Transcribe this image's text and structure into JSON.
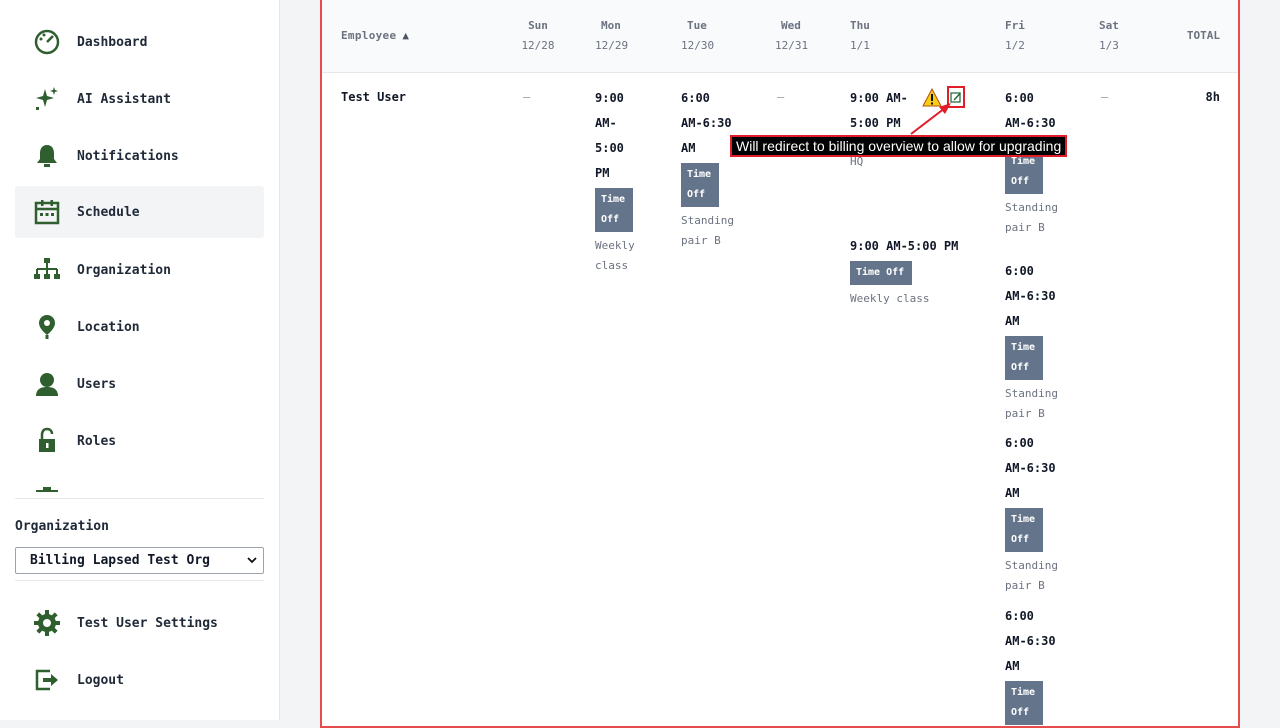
{
  "sidebar": {
    "items": [
      {
        "label": "Dashboard",
        "icon": "dashboard-icon"
      },
      {
        "label": "AI Assistant",
        "icon": "sparkle-icon"
      },
      {
        "label": "Notifications",
        "icon": "bell-icon"
      },
      {
        "label": "Schedule",
        "icon": "calendar-icon",
        "active": true
      },
      {
        "label": "Organization",
        "icon": "org-chart-icon"
      },
      {
        "label": "Location",
        "icon": "map-pin-icon"
      },
      {
        "label": "Users",
        "icon": "user-icon"
      },
      {
        "label": "Roles",
        "icon": "unlock-icon"
      }
    ],
    "organization_label": "Organization",
    "organization_selected": "Billing Lapsed Test Org",
    "settings_label": "Test User Settings",
    "logout_label": "Logout"
  },
  "colors": {
    "icon": "#2f5f2f",
    "badge": "#64748b",
    "highlight": "#e11d2a"
  },
  "schedule": {
    "header": {
      "employee": "Employee",
      "sort_indicator": "▲",
      "days": [
        {
          "day": "Sun",
          "date": "12/28"
        },
        {
          "day": "Mon",
          "date": "12/29"
        },
        {
          "day": "Tue",
          "date": "12/30"
        },
        {
          "day": "Wed",
          "date": "12/31"
        },
        {
          "day": "Thu",
          "date": "1/1"
        },
        {
          "day": "Fri",
          "date": "1/2"
        },
        {
          "day": "Sat",
          "date": "1/3"
        }
      ],
      "total": "TOTAL"
    },
    "row": {
      "employee": "Test User",
      "empty": "–",
      "total": "8h",
      "mon": {
        "time": [
          "9:00",
          "AM-",
          "5:00",
          "PM"
        ],
        "badge": [
          "Time",
          "Off"
        ],
        "note": [
          "Weekly",
          "class"
        ]
      },
      "tue": {
        "time": [
          "6:00",
          "AM-6:30",
          "AM"
        ],
        "badge": [
          "Time",
          "Off"
        ],
        "note": [
          "Standing",
          "pair B"
        ]
      },
      "thu1": {
        "time": [
          "9:00 AM-",
          "5:00 PM"
        ],
        "location": "HQ"
      },
      "thu2": {
        "time": "9:00 AM-5:00 PM",
        "badge": "Time Off",
        "note": "Weekly class"
      },
      "fri": [
        {
          "time": [
            "6:00",
            "AM-6:30"
          ],
          "badge": [
            "Time",
            "Off"
          ],
          "note": [
            "Standing",
            "pair B"
          ]
        },
        {
          "time": [
            "6:00",
            "AM-6:30",
            "AM"
          ],
          "badge": [
            "Time",
            "Off"
          ],
          "note": [
            "Standing",
            "pair B"
          ]
        },
        {
          "time": [
            "6:00",
            "AM-6:30",
            "AM"
          ],
          "badge": [
            "Time",
            "Off"
          ],
          "note": [
            "Standing",
            "pair B"
          ]
        },
        {
          "time": [
            "6:00",
            "AM-6:30",
            "AM"
          ],
          "badge": [
            "Time",
            "Off"
          ]
        }
      ]
    }
  },
  "annotation": {
    "tooltip": "Will redirect to billing overview to allow for upgrading"
  }
}
